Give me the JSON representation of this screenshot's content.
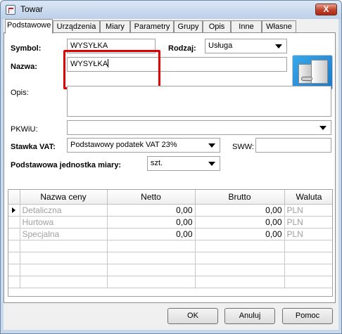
{
  "window": {
    "title": "Towar",
    "close_label": "X"
  },
  "tabs": [
    {
      "label": "Podstawowe",
      "active": true
    },
    {
      "label": "Urządzenia"
    },
    {
      "label": "Miary"
    },
    {
      "label": "Parametry"
    },
    {
      "label": "Grupy"
    },
    {
      "label": "Opis"
    },
    {
      "label": "Inne"
    },
    {
      "label": "Własne"
    }
  ],
  "form": {
    "symbol_label": "Symbol:",
    "symbol_value": "WYSYŁKA",
    "rodzaj_label": "Rodzaj:",
    "rodzaj_value": "Usługa",
    "nazwa_label": "Nazwa:",
    "nazwa_value": "WYSYŁKA",
    "opis_label": "Opis:",
    "opis_value": "",
    "pkwiu_label": "PKWiU:",
    "pkwiu_value": "",
    "stawka_label": "Stawka VAT:",
    "stawka_value": "Podstawowy podatek VAT 23%",
    "sww_label": "SWW:",
    "sww_value": "",
    "jednostka_label": "Podstawowa jednostka miary:",
    "jednostka_value": "szt."
  },
  "prices": {
    "headers": [
      "Nazwa ceny",
      "Netto",
      "Brutto",
      "Waluta"
    ],
    "rows": [
      {
        "name": "Detaliczna",
        "netto": "0,00",
        "brutto": "0,00",
        "waluta": "PLN"
      },
      {
        "name": "Hurtowa",
        "netto": "0,00",
        "brutto": "0,00",
        "waluta": "PLN"
      },
      {
        "name": "Specjalna",
        "netto": "0,00",
        "brutto": "0,00",
        "waluta": "PLN"
      }
    ]
  },
  "buttons": {
    "ok": "OK",
    "cancel": "Anuluj",
    "help": "Pomoc"
  },
  "colors": {
    "highlight": "#e00000",
    "titlebar": "#c9d9ec",
    "close": "#c0402a"
  }
}
